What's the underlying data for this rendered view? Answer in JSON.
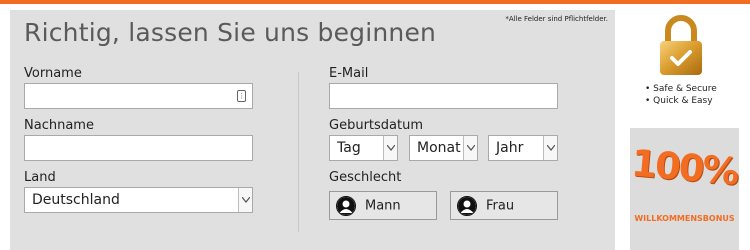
{
  "colors": {
    "accent": "#f26d21",
    "panel": "#e0e0e0"
  },
  "form": {
    "title": "Richtig, lassen Sie uns beginnen",
    "required_note": "*Alle Felder sind Pflichtfelder.",
    "first_name": {
      "label": "Vorname",
      "value": ""
    },
    "last_name": {
      "label": "Nachname",
      "value": ""
    },
    "country": {
      "label": "Land",
      "value": "Deutschland"
    },
    "email": {
      "label": "E-Mail",
      "value": ""
    },
    "birthdate": {
      "label": "Geburtsdatum",
      "day": "Tag",
      "month": "Monat",
      "year": "Jahr"
    },
    "gender": {
      "label": "Geschlecht",
      "male": "Mann",
      "female": "Frau"
    }
  },
  "security": {
    "icon": "lock-icon",
    "bullets": [
      "• Safe & Secure",
      "• Quick & Easy"
    ]
  },
  "promo": {
    "percent": "100%",
    "text": "WILLKOMMENSBONUS"
  }
}
